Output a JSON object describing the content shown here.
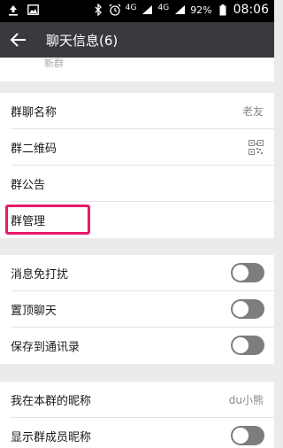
{
  "status_bar": {
    "network_4g_a": "4G",
    "network_4g_b": "4G",
    "battery": "92%",
    "time": "08:06"
  },
  "header": {
    "title": "聊天信息(6)"
  },
  "partial_row": {
    "text": "新群"
  },
  "group_info": {
    "name_label": "群聊名称",
    "name_value": "老友",
    "qr_label": "群二维码",
    "announcement_label": "群公告",
    "manage_label": "群管理"
  },
  "settings": {
    "mute_label": "消息免打扰",
    "pin_label": "置顶聊天",
    "save_label": "保存到通讯录"
  },
  "nickname": {
    "my_nickname_label": "我在本群的昵称",
    "my_nickname_value": "du小熊",
    "show_nicknames_label": "显示群成员昵称"
  },
  "colors": {
    "titlebar": "#393a3f",
    "highlight": "#e8196a",
    "toggle_off": "#7d7d7d"
  }
}
